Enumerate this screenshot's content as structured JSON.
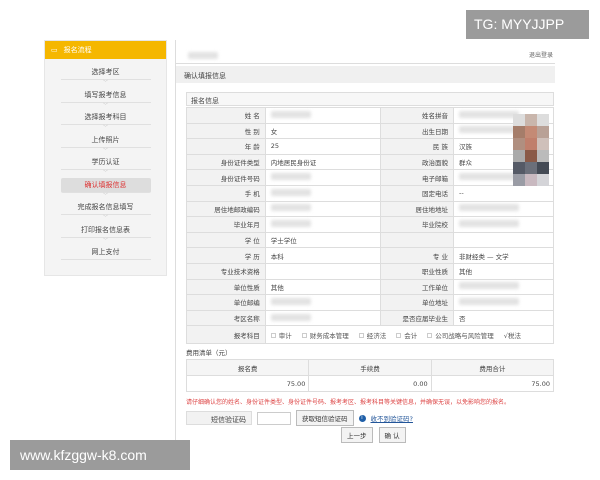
{
  "sidebar": {
    "title": "报名流程",
    "steps": [
      "选择考区",
      "填写报考信息",
      "选择报考科目",
      "上传照片",
      "学历认证",
      "确认填报信息",
      "完成报名信息填写",
      "打印报名信息表",
      "网上支付"
    ],
    "active_index": 5
  },
  "header": {
    "logout": "退出登录",
    "breadcrumb": "确认填报信息"
  },
  "form": {
    "section_title": "报名信息",
    "rows": [
      [
        "姓 名",
        "",
        "姓名拼音",
        ""
      ],
      [
        "性 别",
        "女",
        "出生日期",
        ""
      ],
      [
        "年 龄",
        "25",
        "民 族",
        "汉族"
      ],
      [
        "身份证件类型",
        "内地居民身份证",
        "政治面貌",
        "群众"
      ],
      [
        "身份证件号码",
        "",
        "电子邮箱",
        ""
      ],
      [
        "手 机",
        "",
        "固定电话",
        "--"
      ],
      [
        "居住地邮政编码",
        "",
        "居住地地址",
        ""
      ],
      [
        "毕业年月",
        "",
        "毕业院校",
        ""
      ],
      [
        "学 位",
        "学士学位",
        "",
        ""
      ],
      [
        "学 历",
        "本科",
        "专 业",
        "非财经类 — 文学"
      ],
      [
        "专业技术资格",
        "",
        "职业性质",
        "其他"
      ],
      [
        "单位性质",
        "其他",
        "工作单位",
        ""
      ],
      [
        "单位邮编",
        "",
        "单位地址",
        ""
      ],
      [
        "考区名称",
        "",
        "是否应届毕业生",
        "否"
      ]
    ],
    "subject_label": "报考科目",
    "subjects": [
      {
        "name": "审计",
        "checked": false
      },
      {
        "name": "财务成本管理",
        "checked": false
      },
      {
        "name": "经济法",
        "checked": false
      },
      {
        "name": "会计",
        "checked": false
      },
      {
        "name": "公司战略与风险管理",
        "checked": false
      },
      {
        "name": "税法",
        "checked": true
      }
    ]
  },
  "fees": {
    "title": "费用清单（元）",
    "headers": [
      "报名费",
      "手续费",
      "费用合计"
    ],
    "values": [
      "75.00",
      "0.00",
      "75.00"
    ]
  },
  "warning": "请仔细确认您的姓名、身份证件类型、身份证件号码、报考考区、报考科目等关键信息，并确保无误，以免影响您的报名。",
  "sms": {
    "label": "短信验证码",
    "value": "",
    "get_code": "获取短信验证码",
    "help": "收不到验证码?"
  },
  "buttons": {
    "prev": "上一步",
    "confirm": "确 认"
  },
  "watermarks": [
    "TG: MYYJJPP",
    "www.kfzggw-k8.com"
  ]
}
